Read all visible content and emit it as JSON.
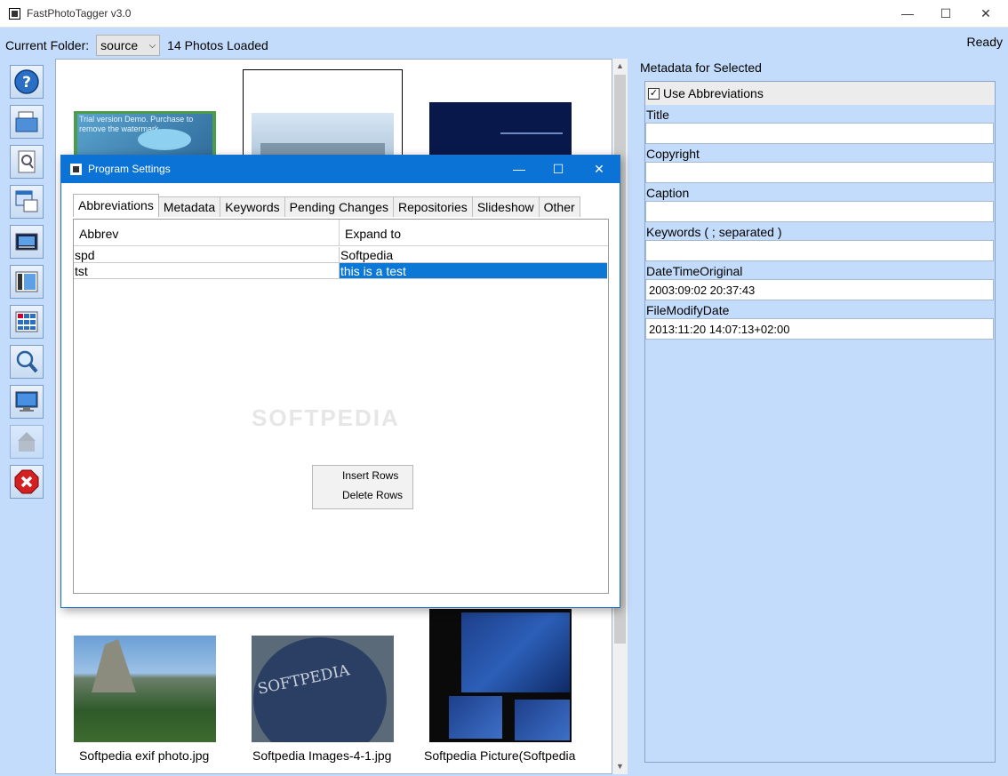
{
  "window": {
    "title": "FastPhotoTagger v3.0",
    "minimize": "—",
    "maximize": "☐",
    "close": "✕"
  },
  "topbar": {
    "folder_label": "Current Folder:",
    "folder_value": "source",
    "photos_loaded": "14 Photos Loaded",
    "status": "Ready"
  },
  "toolbar": [
    {
      "icon": "help-icon"
    },
    {
      "icon": "open-folder-icon"
    },
    {
      "icon": "preview-icon"
    },
    {
      "icon": "copy-windows-icon"
    },
    {
      "icon": "image-view-icon"
    },
    {
      "icon": "filmstrip-icon"
    },
    {
      "icon": "grid-view-icon"
    },
    {
      "icon": "search-icon"
    },
    {
      "icon": "monitor-icon"
    },
    {
      "icon": "disabled-tag-icon"
    },
    {
      "icon": "exit-icon"
    }
  ],
  "photos": {
    "thumbnail_text": "Trial version Demo. Purchase to remove the watermark",
    "captions": [
      "Softpedia exif photo.jpg",
      "Softpedia Images-4-1.jpg",
      "Softpedia Picture(Softpedia"
    ],
    "stamp_text": "SOFTPEDIA"
  },
  "metadata": {
    "header": "Metadata for Selected",
    "use_abbreviations": "Use Abbreviations",
    "use_abbreviations_checked": true,
    "fields": [
      {
        "label": "Title",
        "value": ""
      },
      {
        "label": "Copyright",
        "value": ""
      },
      {
        "label": "Caption",
        "value": ""
      },
      {
        "label": "Keywords ( ; separated )",
        "value": ""
      },
      {
        "label": "DateTimeOriginal",
        "value": "2003:09:02 20:37:43"
      },
      {
        "label": "FileModifyDate",
        "value": "2013:11:20 14:07:13+02:00"
      }
    ]
  },
  "dialog": {
    "title": "Program Settings",
    "tabs": [
      "Abbreviations",
      "Metadata",
      "Keywords",
      "Pending Changes",
      "Repositories",
      "Slideshow",
      "Other"
    ],
    "active_tab": "Abbreviations",
    "columns": [
      "Abbrev",
      "Expand to"
    ],
    "rows": [
      {
        "abbrev": "spd",
        "expand": "Softpedia"
      },
      {
        "abbrev": "tst",
        "expand": "this is a test"
      }
    ],
    "context_menu": [
      "Insert Rows",
      "Delete Rows"
    ],
    "watermark": "SOFTPEDIA"
  },
  "colors": {
    "accent": "#0c73d6",
    "panel_bg": "#c4dcfb",
    "selection": "#0a78d4"
  }
}
